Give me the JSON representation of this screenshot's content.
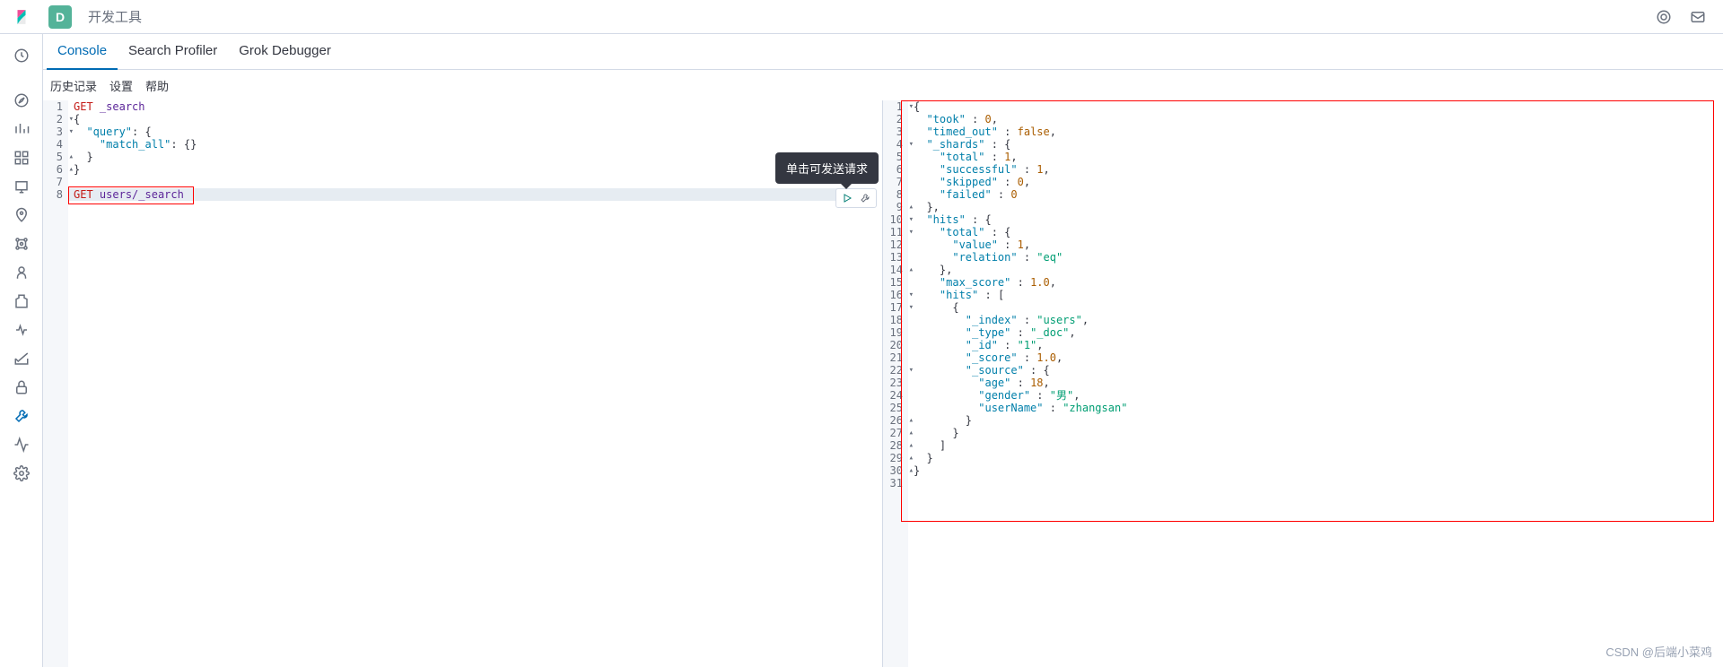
{
  "header": {
    "space_initial": "D",
    "breadcrumb": "开发工具"
  },
  "tabs": [
    {
      "label": "Console",
      "active": true
    },
    {
      "label": "Search Profiler",
      "active": false
    },
    {
      "label": "Grok Debugger",
      "active": false
    }
  ],
  "subbar": {
    "history": "历史记录",
    "settings": "设置",
    "help": "帮助"
  },
  "tooltip": "单击可发送请求",
  "request_editor": {
    "lines": [
      {
        "n": 1,
        "method": "GET",
        "url": "_search"
      },
      {
        "n": 2,
        "fold": "▾",
        "raw": "{"
      },
      {
        "n": 3,
        "fold": "▾",
        "indent": 1,
        "key": "query",
        "after": ": {"
      },
      {
        "n": 4,
        "indent": 2,
        "key": "match_all",
        "after": ": {}"
      },
      {
        "n": 5,
        "fold": "▴",
        "indent": 1,
        "raw": "}"
      },
      {
        "n": 6,
        "fold": "▴",
        "raw": "}"
      },
      {
        "n": 7
      },
      {
        "n": 8,
        "method": "GET",
        "url": "users/_search"
      }
    ],
    "highlighted_line": 8
  },
  "response_editor": {
    "lines": [
      {
        "n": 1,
        "fold": "▾",
        "raw": "{"
      },
      {
        "n": 2,
        "indent": 1,
        "key": "took",
        "val_num": 0,
        "comma": true
      },
      {
        "n": 3,
        "indent": 1,
        "key": "timed_out",
        "val_kw": "false",
        "comma": true
      },
      {
        "n": 4,
        "fold": "▾",
        "indent": 1,
        "key": "_shards",
        "after": " : {"
      },
      {
        "n": 5,
        "indent": 2,
        "key": "total",
        "val_num": 1,
        "comma": true
      },
      {
        "n": 6,
        "indent": 2,
        "key": "successful",
        "val_num": 1,
        "comma": true
      },
      {
        "n": 7,
        "indent": 2,
        "key": "skipped",
        "val_num": 0,
        "comma": true
      },
      {
        "n": 8,
        "indent": 2,
        "key": "failed",
        "val_num": 0
      },
      {
        "n": 9,
        "fold": "▴",
        "indent": 1,
        "raw": "},"
      },
      {
        "n": 10,
        "fold": "▾",
        "indent": 1,
        "key": "hits",
        "after": " : {"
      },
      {
        "n": 11,
        "fold": "▾",
        "indent": 2,
        "key": "total",
        "after": " : {"
      },
      {
        "n": 12,
        "indent": 3,
        "key": "value",
        "val_num": 1,
        "comma": true
      },
      {
        "n": 13,
        "indent": 3,
        "key": "relation",
        "val_str": "eq"
      },
      {
        "n": 14,
        "fold": "▴",
        "indent": 2,
        "raw": "},"
      },
      {
        "n": 15,
        "indent": 2,
        "key": "max_score",
        "val_num": "1.0",
        "comma": true
      },
      {
        "n": 16,
        "fold": "▾",
        "indent": 2,
        "key": "hits",
        "after": " : ["
      },
      {
        "n": 17,
        "fold": "▾",
        "indent": 3,
        "raw": "{"
      },
      {
        "n": 18,
        "indent": 4,
        "key": "_index",
        "val_str": "users",
        "comma": true
      },
      {
        "n": 19,
        "indent": 4,
        "key": "_type",
        "val_str": "_doc",
        "comma": true
      },
      {
        "n": 20,
        "indent": 4,
        "key": "_id",
        "val_str": "1",
        "comma": true
      },
      {
        "n": 21,
        "indent": 4,
        "key": "_score",
        "val_num": "1.0",
        "comma": true
      },
      {
        "n": 22,
        "fold": "▾",
        "indent": 4,
        "key": "_source",
        "after": " : {"
      },
      {
        "n": 23,
        "indent": 5,
        "key": "age",
        "val_num": 18,
        "comma": true
      },
      {
        "n": 24,
        "indent": 5,
        "key": "gender",
        "val_str": "男",
        "comma": true
      },
      {
        "n": 25,
        "indent": 5,
        "key": "userName",
        "val_str": "zhangsan"
      },
      {
        "n": 26,
        "fold": "▴",
        "indent": 4,
        "raw": "}"
      },
      {
        "n": 27,
        "fold": "▴",
        "indent": 3,
        "raw": "}"
      },
      {
        "n": 28,
        "fold": "▴",
        "indent": 2,
        "raw": "]"
      },
      {
        "n": 29,
        "fold": "▴",
        "indent": 1,
        "raw": "}"
      },
      {
        "n": 30,
        "fold": "▴",
        "raw": "}"
      },
      {
        "n": 31
      }
    ]
  },
  "watermark": "CSDN @后端小菜鸡"
}
